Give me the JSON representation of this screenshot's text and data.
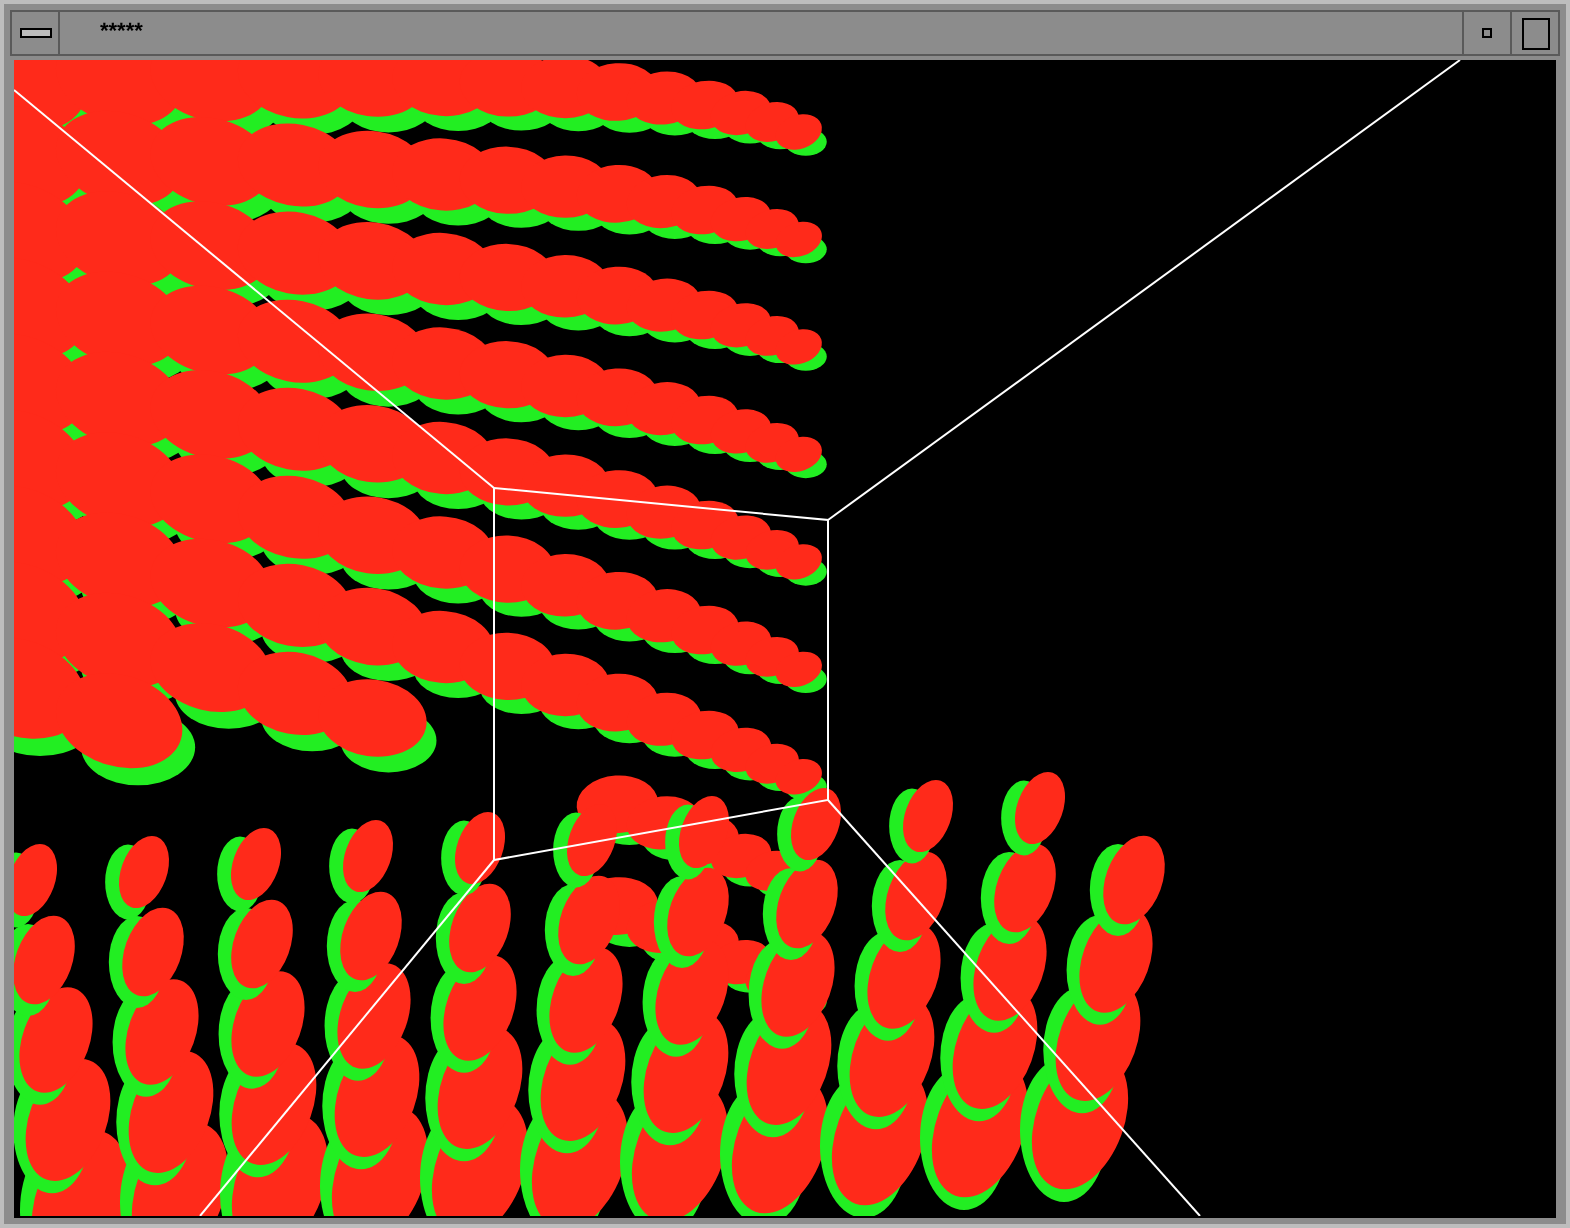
{
  "window": {
    "title": "*****"
  }
}
